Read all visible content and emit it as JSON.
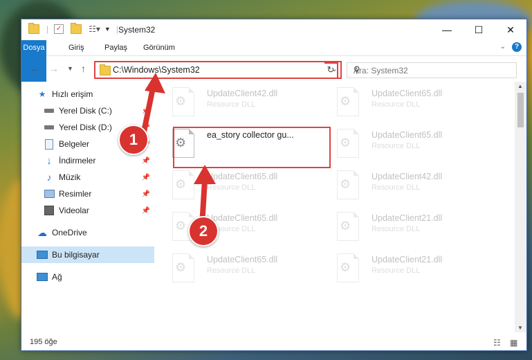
{
  "window": {
    "title": "System32"
  },
  "ribbon": {
    "tabs": [
      "Dosya",
      "Giriş",
      "Paylaş",
      "Görünüm"
    ]
  },
  "address": {
    "path": "C:\\Windows\\System32"
  },
  "search": {
    "placeholder": "Ara: System32"
  },
  "sidebar": {
    "items": [
      {
        "label": "Hızlı erişim",
        "icon": "star-icon"
      },
      {
        "label": "Yerel Disk (C:)",
        "icon": "drive-icon"
      },
      {
        "label": "Yerel Disk (D:)",
        "icon": "drive-icon"
      },
      {
        "label": "Belgeler",
        "icon": "documents-icon"
      },
      {
        "label": "İndirmeler",
        "icon": "download-icon"
      },
      {
        "label": "Müzik",
        "icon": "music-icon"
      },
      {
        "label": "Resimler",
        "icon": "pictures-icon"
      },
      {
        "label": "Videolar",
        "icon": "videos-icon"
      },
      {
        "label": "OneDrive",
        "icon": "cloud-icon"
      },
      {
        "label": "Bu bilgisayar",
        "icon": "computer-icon"
      },
      {
        "label": "Ağ",
        "icon": "network-icon"
      }
    ]
  },
  "files": [
    {
      "name": "UpdateClient42.dll",
      "type": "Resource DLL"
    },
    {
      "name": "UpdateClient65.dll",
      "type": "Resource DLL"
    },
    {
      "name": "ea_story collector gu...",
      "type": ""
    },
    {
      "name": "UpdateClient65.dll",
      "type": "Resource DLL"
    },
    {
      "name": "UpdateClient65.dll",
      "type": "Resource DLL"
    },
    {
      "name": "UpdateClient42.dll",
      "type": "Resource DLL"
    },
    {
      "name": "UpdateClient65.dll",
      "type": "Resource DLL"
    },
    {
      "name": "UpdateClient21.dll",
      "type": "Resource DLL"
    },
    {
      "name": "UpdateClient65.dll",
      "type": "Resource DLL"
    },
    {
      "name": "UpdateClient21.dll",
      "type": "Resource DLL"
    }
  ],
  "status": {
    "count": "195 öğe"
  },
  "annotations": {
    "step1": "1",
    "step2": "2",
    "color": "#d9332f"
  }
}
